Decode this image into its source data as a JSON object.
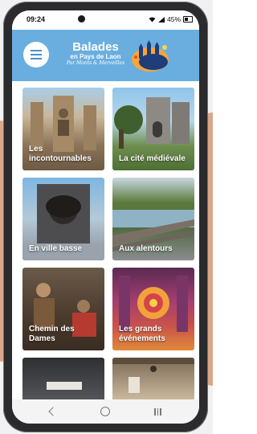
{
  "status_bar": {
    "time": "09:24",
    "battery": "45%"
  },
  "header": {
    "title": "Balades",
    "subtitle": "en Pays de Laon",
    "byline": "Par Monts & Merveilles",
    "background_color": "#6aaee0"
  },
  "icons": {
    "menu": "hamburger-menu-icon",
    "logo": "cathedral-logo-icon",
    "back": "back-icon",
    "home": "home-icon",
    "recents": "recent-apps-icon"
  },
  "tiles": [
    {
      "label": "Les incontournables"
    },
    {
      "label": "La cité médiévale"
    },
    {
      "label": "En ville basse"
    },
    {
      "label": "Aux alentours"
    },
    {
      "label": "Chemin des Dames"
    },
    {
      "label": "Les grands événements"
    },
    {
      "label": ""
    },
    {
      "label": ""
    }
  ]
}
